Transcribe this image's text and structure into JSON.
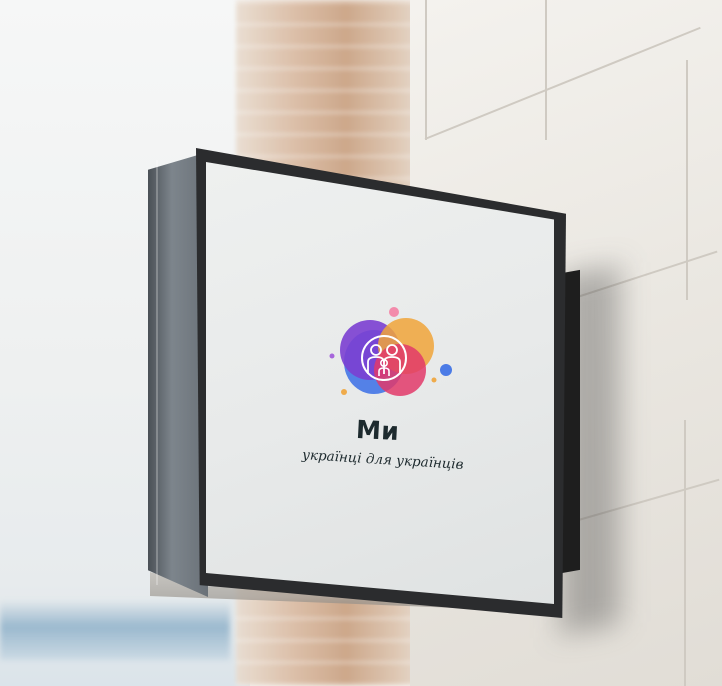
{
  "scene": {
    "description_colors": {
      "wall": "#ebe8e2",
      "sign_frame": "#2b2c2e",
      "sign_face": "#eef0ef",
      "text": "#1d2a2e"
    }
  },
  "sign": {
    "brand_name": "Ми",
    "tagline": "українці для українців",
    "logo_icon": "family-icon",
    "logo_colors": [
      "#7b3fd1",
      "#f0a43a",
      "#e23a6a",
      "#3a6fe6",
      "#f47aa0"
    ]
  }
}
